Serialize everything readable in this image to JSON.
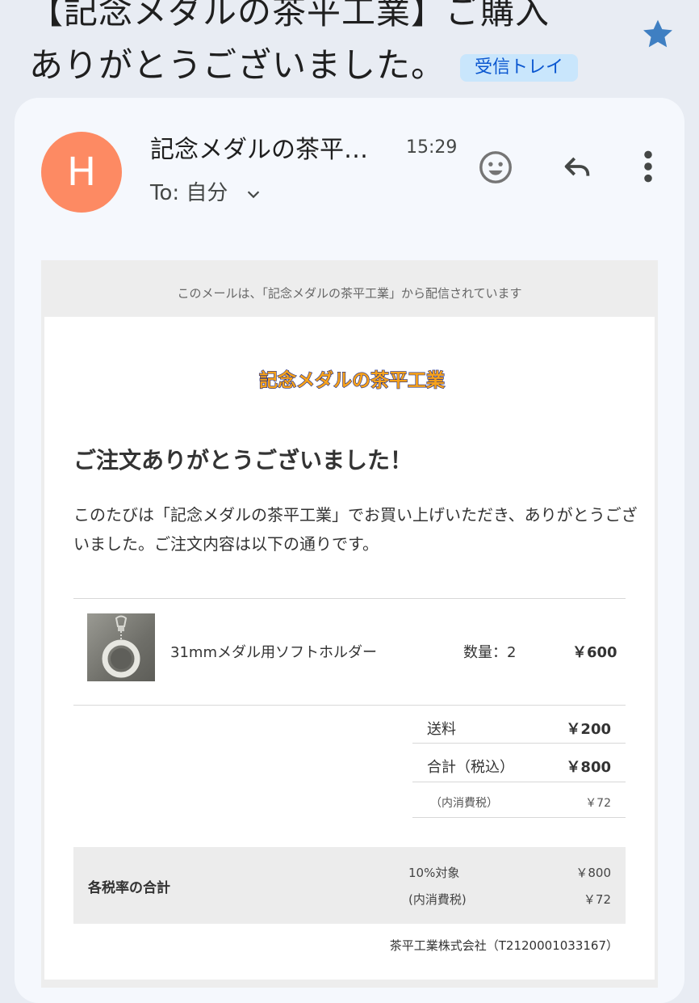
{
  "subject": {
    "line1": "【記念メダルの茶平工業】ご購入",
    "line2": "ありがとうございました。",
    "label": "受信トレイ"
  },
  "header": {
    "avatar_letter": "H",
    "sender": "記念メダルの茶平…",
    "time": "15:29",
    "to": "To: 自分"
  },
  "icons": {
    "star": "star-icon",
    "emoji": "emoji-reaction-icon",
    "reply": "reply-icon",
    "more": "more-vert-icon"
  },
  "colors": {
    "star": "#3f7fc2",
    "avatar": "#fd8a63",
    "label_bg": "#c9e6fc",
    "label_text": "#0b57d0",
    "logo_fill": "#f7a21b",
    "logo_outline": "#1a2a8a"
  },
  "mail": {
    "notice": "このメールは、「記念メダルの茶平工業」から配信されています",
    "logo_text": "記念メダルの茶平工業",
    "headline": "ご注文ありがとうございました！",
    "intro": "このたびは「記念メダルの茶平工業」でお買い上げいただき、ありがとうございました。ご注文内容は以下の通りです。",
    "item": {
      "name": "31mmメダル用ソフトホルダー",
      "quantity": "数量：2",
      "price": "￥600"
    },
    "summary": {
      "shipping_label": "送料",
      "shipping_value": "￥200",
      "total_label": "合計（税込）",
      "total_value": "￥800",
      "tax_label": "（内消費税）",
      "tax_value": "￥72"
    },
    "tax_rates": {
      "title": "各税率の合計",
      "rate_label": "10%対象",
      "rate_value": "￥800",
      "tax_label": "(内消費税)",
      "tax_value": "￥72"
    },
    "company": "茶平工業株式会社（T2120001033167）"
  }
}
